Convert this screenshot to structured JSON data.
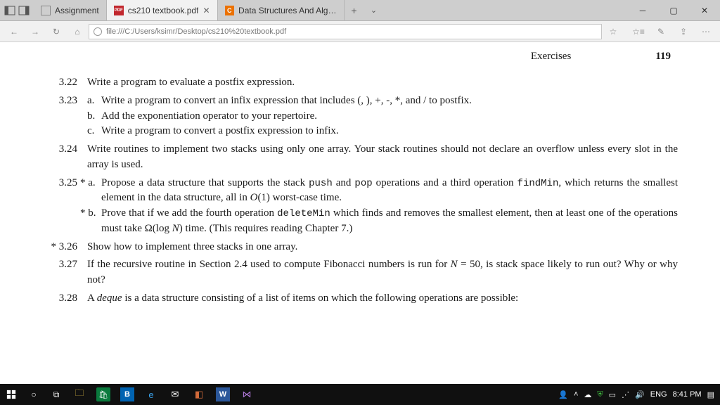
{
  "browser": {
    "tabs": [
      {
        "label": "Assignment",
        "favicon": "□"
      },
      {
        "label": "cs210 textbook.pdf",
        "favicon": "PDF",
        "active": true
      },
      {
        "label": "Data Structures And Algorit",
        "favicon": "C"
      }
    ],
    "url": "file:///C:/Users/ksimr/Desktop/cs210%20textbook.pdf"
  },
  "page": {
    "section": "Exercises",
    "number": "119",
    "exercises": [
      {
        "num": "3.22",
        "text": "Write a program to evaluate a postfix expression."
      },
      {
        "num": "3.23",
        "subs": [
          {
            "let": "a.",
            "text": "Write a program to convert an infix expression that includes (, ), +, -, *, and / to postfix."
          },
          {
            "let": "b.",
            "text": "Add the exponentiation operator to your repertoire."
          },
          {
            "let": "c.",
            "text": "Write a program to convert a postfix expression to infix."
          }
        ]
      },
      {
        "num": "3.24",
        "text": "Write routines to implement two stacks using only one array. Your stack routines should not declare an overflow unless every slot in the array is used."
      },
      {
        "num": "3.25",
        "subs": [
          {
            "let": "* a.",
            "text_html": "Propose a data structure that supports the stack <span class='mono'>push</span> and <span class='mono'>pop</span> operations and a third operation <span class='mono'>findMin</span>, which returns the smallest element in the data structure, all in <span class='ital'>O</span>(1) worst-case time."
          },
          {
            "let": "* b.",
            "text_html": "Prove that if we add the fourth operation <span class='mono'>deleteMin</span> which finds and removes the smallest element, then at least one of the operations must take Ω(log <span class='ital'>N</span>) time. (This requires reading Chapter 7.)"
          }
        ]
      },
      {
        "num": "* 3.26",
        "text": "Show how to implement three stacks in one array."
      },
      {
        "num": "3.27",
        "text_html": "If the recursive routine in Section 2.4 used to compute Fibonacci numbers is run for <span class='ital'>N</span> = 50, is stack space likely to run out? Why or why not?"
      },
      {
        "num": "3.28",
        "text_html": "A <span class='ital'>deque</span> is a data structure consisting of a list of items on which the following operations are possible:"
      }
    ]
  },
  "taskbar": {
    "lang": "ENG",
    "time": "8:41 PM"
  }
}
